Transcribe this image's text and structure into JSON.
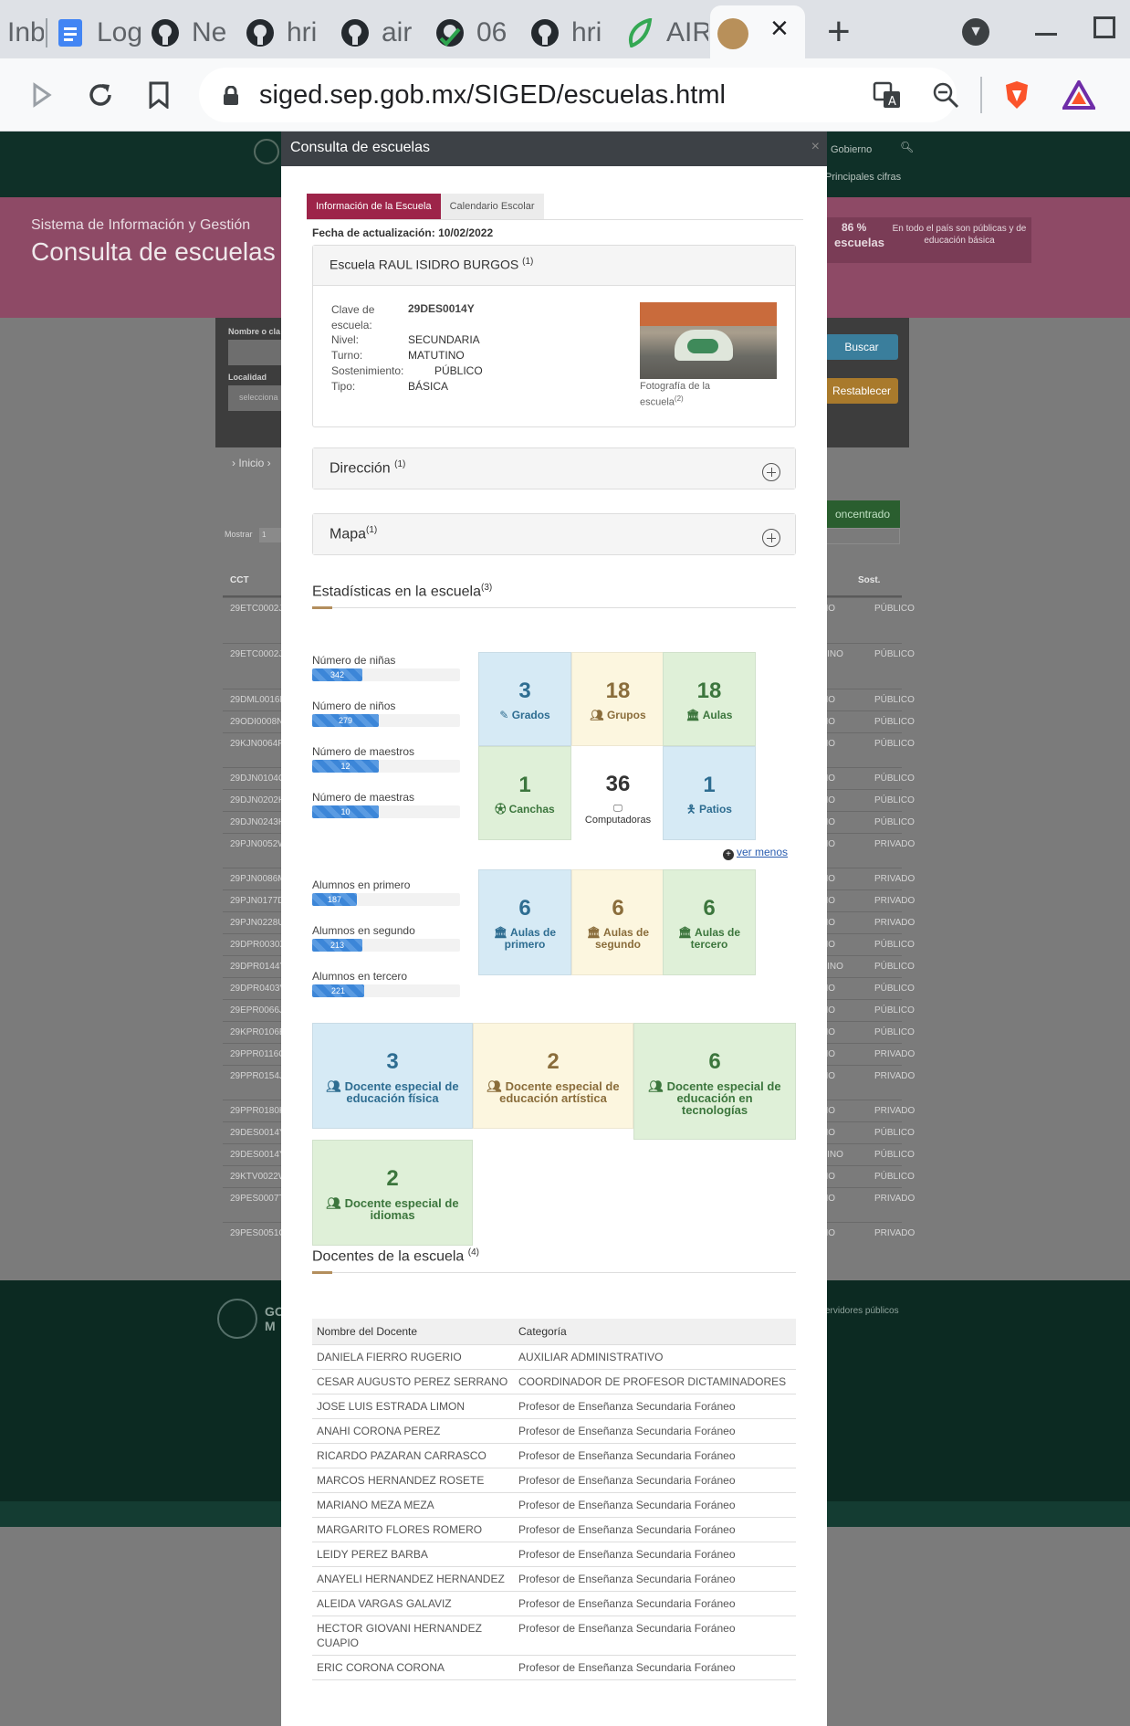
{
  "browser": {
    "tabs": [
      {
        "label": "Inb",
        "icon": "gmail-icon"
      },
      {
        "label": "Log",
        "icon": "google-docs-icon"
      },
      {
        "label": "Ne",
        "icon": "github-icon"
      },
      {
        "label": "hri",
        "icon": "github-icon"
      },
      {
        "label": "air",
        "icon": "github-icon"
      },
      {
        "label": "06",
        "icon": "github-check-icon"
      },
      {
        "label": "hri",
        "icon": "github-icon"
      },
      {
        "label": "AIR",
        "icon": "leaf-icon"
      }
    ],
    "active_tab_close": "×",
    "new_tab": "+",
    "url": "siged.sep.gob.mx/SIGED/escuelas.html",
    "brave_badge": "1",
    "rewards_badge": "1"
  },
  "background": {
    "header_links": [
      "Gobierno",
      "Principales cifras"
    ],
    "system_title": "Sistema de Información y Gestión",
    "page_title": "Consulta de escuelas",
    "stat_pct": "86 %",
    "stat_label": "escuelas",
    "stat_note": "En todo el país son públicas y de educación básica",
    "search_label_1": "Nombre o cla",
    "search_label_2": "Localidad",
    "search_select": "selecciona",
    "buscar": "Buscar",
    "restablecer": "Restablecer",
    "breadcrumb": "› Inicio ›",
    "mostrar": "Mostrar",
    "mostrar_val": "1",
    "concentrado": "oncentrado",
    "col_cct": "CCT",
    "col_sost": "Sost.",
    "rows": [
      {
        "cct": "29ETC0002J",
        "mid": "NO",
        "sost": "PÚBLICO"
      },
      {
        "cct": "29ETC0002J",
        "mid": "TINO",
        "sost": "PÚBLICO"
      },
      {
        "cct": "29DML0016L",
        "mid": "NO",
        "sost": "PÚBLICO"
      },
      {
        "cct": "29ODI0008N",
        "mid": "NO",
        "sost": "PÚBLICO"
      },
      {
        "cct": "29KJN0064F",
        "mid": "NO",
        "sost": "PÚBLICO"
      },
      {
        "cct": "29DJN0104G",
        "mid": "NO",
        "sost": "PÚBLICO"
      },
      {
        "cct": "29DJN0202H",
        "mid": "NO",
        "sost": "PÚBLICO"
      },
      {
        "cct": "29DJN0243H",
        "mid": "NO",
        "sost": "PÚBLICO"
      },
      {
        "cct": "29PJN0052W",
        "mid": "NO",
        "sost": "PRIVADO"
      },
      {
        "cct": "29PJN0086M",
        "mid": "NO",
        "sost": "PRIVADO"
      },
      {
        "cct": "29PJN0177D",
        "mid": "NO",
        "sost": "PRIVADO"
      },
      {
        "cct": "29PJN0228U",
        "mid": "NO",
        "sost": "PRIVADO"
      },
      {
        "cct": "29DPR0030X",
        "mid": "NO",
        "sost": "PÚBLICO"
      },
      {
        "cct": "29DPR0144Y",
        "mid": "TINO",
        "sost": "PÚBLICO"
      },
      {
        "cct": "29DPR0403V",
        "mid": "NO",
        "sost": "PÚBLICO"
      },
      {
        "cct": "29EPR0066J",
        "mid": "NO",
        "sost": "PÚBLICO"
      },
      {
        "cct": "29KPR0106E",
        "mid": "NO",
        "sost": "PÚBLICO"
      },
      {
        "cct": "29PPR0116G",
        "mid": "NO",
        "sost": "PRIVADO"
      },
      {
        "cct": "29PPR0154J",
        "mid": "NO",
        "sost": "PRIVADO"
      },
      {
        "cct": "29PPR0180H",
        "mid": "NO",
        "sost": "PRIVADO"
      },
      {
        "cct": "29DES0014Y",
        "mid": "NO",
        "sost": "PÚBLICO"
      },
      {
        "cct": "29DES0014Y",
        "mid": "TINO",
        "sost": "PÚBLICO"
      },
      {
        "cct": "29KTV0022W",
        "mid": "NO",
        "sost": "PÚBLICO"
      },
      {
        "cct": "29PES0007T",
        "mid": "NO",
        "sost": "PRIVADO"
      },
      {
        "cct": "29PES0051G",
        "mid": "NO",
        "sost": "PRIVADO"
      }
    ],
    "footer_right": "ervidores públicos",
    "footer_logo": "GO M"
  },
  "modal": {
    "title": "Consulta de escuelas",
    "close": "×",
    "tabs": [
      "Información de la Escuela",
      "Calendario Escolar"
    ],
    "updated_label": "Fecha de actualización:",
    "updated_value": "10/02/2022",
    "school_header": "Escuela RAUL ISIDRO BURGOS",
    "school_header_sup": "(1)",
    "info": [
      {
        "label": "Clave de escuela:",
        "value": "29DES0014Y"
      },
      {
        "label": "Nivel:",
        "value": "SECUNDARIA"
      },
      {
        "label": "Turno:",
        "value": "MATUTINO"
      },
      {
        "label": "Sostenimiento:",
        "value": "PÚBLICO"
      },
      {
        "label": "Tipo:",
        "value": "BÁSICA"
      }
    ],
    "photo_caption": "Fotografía de la escuela",
    "photo_caption_sup": "(2)",
    "direccion": "Dirección",
    "direccion_sup": "(1)",
    "mapa": "Mapa",
    "mapa_sup": "(1)",
    "stats_title": "Estadísticas en la escuela",
    "stats_sup": "(3)",
    "bars": [
      {
        "label": "Número de niñas",
        "value": "342",
        "fill": 0.342
      },
      {
        "label": "Número de niños",
        "value": "279",
        "fill": 0.45
      },
      {
        "label": "Número de maestros",
        "value": "12",
        "fill": 0.45
      },
      {
        "label": "Número de maestras",
        "value": "10",
        "fill": 0.45
      },
      {
        "label": "Alumnos en primero",
        "value": "187",
        "fill": 0.3
      },
      {
        "label": "Alumnos en segundo",
        "value": "213",
        "fill": 0.34
      },
      {
        "label": "Alumnos en tercero",
        "value": "221",
        "fill": 0.35
      }
    ],
    "tiles": [
      {
        "num": "3",
        "label": "Grados",
        "icon": "pencil-icon"
      },
      {
        "num": "18",
        "label": "Grupos",
        "icon": "users-icon"
      },
      {
        "num": "18",
        "label": "Aulas",
        "icon": "classroom-icon"
      },
      {
        "num": "1",
        "label": "Canchas",
        "icon": "soccer-ball-icon"
      },
      {
        "num": "36",
        "label": "Computadoras",
        "icon": "desktop-icon"
      },
      {
        "num": "1",
        "label": "Patios",
        "icon": "child-icon"
      },
      {
        "num": "6",
        "label": "Aulas de primero",
        "icon": "classroom-icon"
      },
      {
        "num": "6",
        "label": "Aulas de segundo",
        "icon": "classroom-icon"
      },
      {
        "num": "6",
        "label": "Aulas de tercero",
        "icon": "classroom-icon"
      }
    ],
    "ver_menos": "ver menos",
    "big_tiles": [
      {
        "num": "3",
        "label": "Docente especial de educación física"
      },
      {
        "num": "2",
        "label": "Docente especial de educación artística"
      },
      {
        "num": "6",
        "label": "Docente especial de educación en tecnologías"
      },
      {
        "num": "2",
        "label": "Docente especial de idiomas"
      }
    ],
    "docentes_title": "Docentes de la escuela",
    "docentes_sup": "(4)",
    "table_headers": [
      "Nombre del Docente",
      "Categoría"
    ],
    "docentes": [
      {
        "name": "DANIELA FIERRO RUGERIO",
        "cat": "AUXILIAR ADMINISTRATIVO"
      },
      {
        "name": "CESAR AUGUSTO PEREZ SERRANO",
        "cat": "COORDINADOR DE PROFESOR DICTAMINADORES"
      },
      {
        "name": "JOSE LUIS ESTRADA LIMON",
        "cat": "Profesor de Enseñanza Secundaria Foráneo"
      },
      {
        "name": "ANAHI CORONA PEREZ",
        "cat": "Profesor de Enseñanza Secundaria Foráneo"
      },
      {
        "name": "RICARDO PAZARAN CARRASCO",
        "cat": "Profesor de Enseñanza Secundaria Foráneo"
      },
      {
        "name": "MARCOS HERNANDEZ ROSETE",
        "cat": "Profesor de Enseñanza Secundaria Foráneo"
      },
      {
        "name": "MARIANO MEZA MEZA",
        "cat": "Profesor de Enseñanza Secundaria Foráneo"
      },
      {
        "name": "MARGARITO FLORES ROMERO",
        "cat": "Profesor de Enseñanza Secundaria Foráneo"
      },
      {
        "name": "LEIDY PEREZ BARBA",
        "cat": "Profesor de Enseñanza Secundaria Foráneo"
      },
      {
        "name": "ANAYELI HERNANDEZ HERNANDEZ",
        "cat": "Profesor de Enseñanza Secundaria Foráneo"
      },
      {
        "name": "ALEIDA VARGAS GALAVIZ",
        "cat": "Profesor de Enseñanza Secundaria Foráneo"
      },
      {
        "name": "HECTOR GIOVANI HERNANDEZ CUAPIO",
        "cat": "Profesor de Enseñanza Secundaria Foráneo"
      },
      {
        "name": "ERIC CORONA CORONA",
        "cat": "Profesor de Enseñanza Secundaria Foráneo"
      }
    ]
  },
  "colors": {
    "accent": "#9d2449",
    "gold": "#b38e5d",
    "tile_blue": "#d6eaf5",
    "tile_yellow": "#fcf6df",
    "tile_green": "#dff0d8"
  }
}
